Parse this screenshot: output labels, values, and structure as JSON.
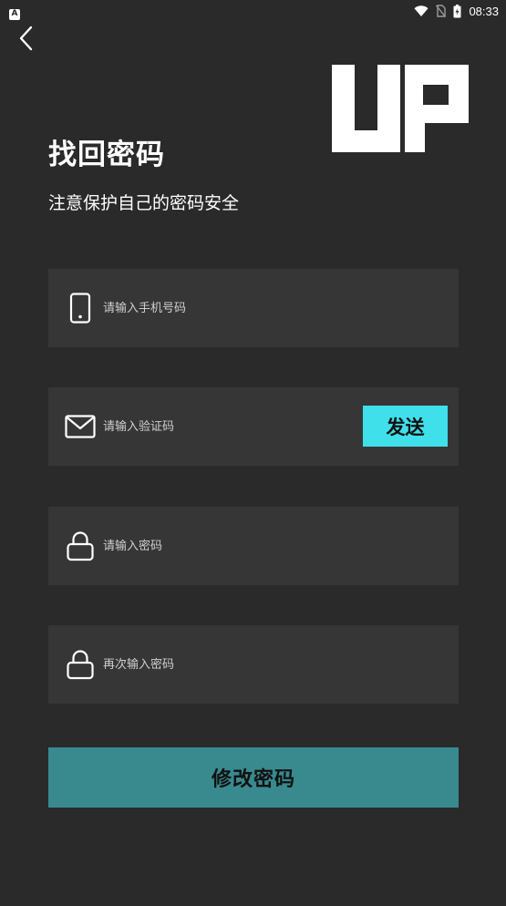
{
  "status_bar": {
    "app_glyph": "A",
    "time": "08:33",
    "icons": [
      "wifi-icon",
      "no-sim-icon",
      "battery-icon"
    ]
  },
  "header": {
    "back_icon": "chevron-left-icon",
    "logo_text": "UP"
  },
  "title": "找回密码",
  "subtitle": "注意保护自己的密码安全",
  "form": {
    "phone": {
      "icon": "phone-icon",
      "placeholder": "请输入手机号码",
      "value": ""
    },
    "code": {
      "icon": "mail-icon",
      "placeholder": "请输入验证码",
      "value": "",
      "send_label": "发送"
    },
    "password": {
      "icon": "lock-icon",
      "placeholder": "请输入密码",
      "value": ""
    },
    "confirm_password": {
      "icon": "lock-icon",
      "placeholder": "再次输入密码",
      "value": ""
    },
    "submit_label": "修改密码"
  },
  "colors": {
    "background": "#2a2a2b",
    "field_bg": "#363637",
    "send_button": "#3fe0ea",
    "submit_button": "#388a8f"
  }
}
